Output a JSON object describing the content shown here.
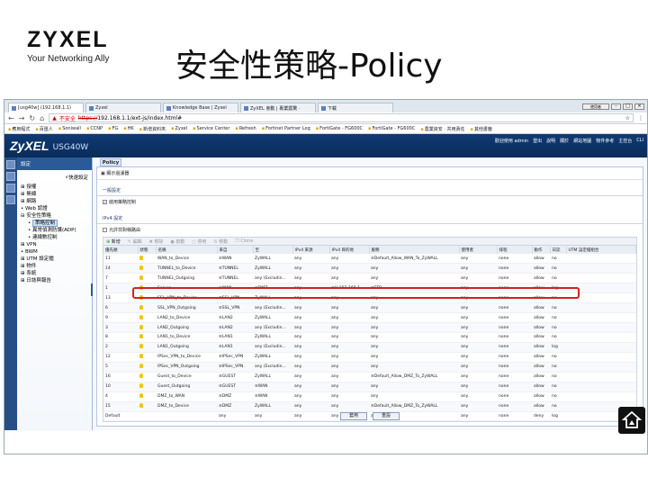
{
  "slide": {
    "logo_brand": "ZYXEL",
    "logo_tagline": "Your Networking Ally",
    "title": "安全性策略-Policy"
  },
  "browser": {
    "tabs": [
      "[usg40w] (192.168.1.1)",
      "Zyxel",
      "Knowledge Base | Zyxel",
      "ZyXEL 會動 | 專業震驚 ·",
      "下載"
    ],
    "window_user": "使用者",
    "insecure_label": "不安全",
    "url_scheme": "https://",
    "url_rest": "192.168.1.1/ext-js/index.html#",
    "bookmarks": [
      "應用程式",
      "百匯人",
      "Soniwall",
      "CCNP",
      "FG",
      "HK",
      "新增資料夾",
      "Zyxel",
      "Service Center",
      "Refresh",
      "Fortinet Partner Log",
      "FortiGate - FG600C",
      "FortiGate - FG600C",
      "農業資安 · 共用責任",
      "其他書籤"
    ]
  },
  "app": {
    "logo": "ZyXEL",
    "model": "USG40W",
    "header_links": [
      "歡迎使用 admin",
      "登出",
      "說明",
      "關於",
      "網站地圖",
      "物件參考",
      "主控台",
      "CLI"
    ],
    "sidebar_title": "設定",
    "quick_setup": "快速設定",
    "tree": [
      {
        "label": "授權",
        "level": 0,
        "icon": "plus-icon"
      },
      {
        "label": "無線",
        "level": 0,
        "icon": "plus-icon"
      },
      {
        "label": "網路",
        "level": 0,
        "icon": "plus-icon"
      },
      {
        "label": "Web 認證",
        "level": 0,
        "icon": "bullet-icon"
      },
      {
        "label": "安全性策略",
        "level": 0,
        "icon": "minus-icon"
      },
      {
        "label": "策略控制",
        "level": 1,
        "icon": "bullet-icon",
        "selected": true
      },
      {
        "label": "異常偵測防護(ADP)",
        "level": 1,
        "icon": "bullet-icon"
      },
      {
        "label": "連線數控制",
        "level": 1,
        "icon": "bullet-icon"
      },
      {
        "label": "VPN",
        "level": 0,
        "icon": "plus-icon"
      },
      {
        "label": "BWM",
        "level": 0,
        "icon": "bullet-icon"
      },
      {
        "label": "UTM 設定檔",
        "level": 0,
        "icon": "plus-icon"
      },
      {
        "label": "物件",
        "level": 0,
        "icon": "plus-icon"
      },
      {
        "label": "系統",
        "level": 0,
        "icon": "plus-icon"
      },
      {
        "label": "日誌與報告",
        "level": 0,
        "icon": "plus-icon"
      }
    ],
    "main_tab": "Policy",
    "show_filter": "顯示過濾器",
    "general_section": "一般設定",
    "enable_policy": "啟用策略控制",
    "ipv4_section": "IPv4 設定",
    "allow_asym": "允許非對稱路由",
    "toolbar": [
      {
        "label": "新增",
        "enabled": true
      },
      {
        "label": "編輯",
        "enabled": false
      },
      {
        "label": "移除",
        "enabled": false
      },
      {
        "label": "啟動",
        "enabled": false
      },
      {
        "label": "停用",
        "enabled": false
      },
      {
        "label": "移動",
        "enabled": false
      },
      {
        "label": "Clone",
        "enabled": false
      }
    ],
    "columns": [
      "優先順",
      "狀態",
      "名稱",
      "來自",
      "至",
      "IPv4 來源",
      "IPv4 目的地",
      "服務",
      "使用者",
      "排程",
      "動作",
      "日誌",
      "UTM 設定檔組合"
    ],
    "rows": [
      [
        "11",
        "",
        "WAN_to_Device",
        "≡WAN",
        "ZyWALL",
        "any",
        "any",
        "≡Default_Allow_WAN_To_ZyWALL",
        "any",
        "none",
        "allow",
        "no",
        ""
      ],
      [
        "14",
        "",
        "TUNNEL_to_Device",
        "≡TUNNEL",
        "ZyWALL",
        "any",
        "any",
        "any",
        "any",
        "none",
        "allow",
        "no",
        ""
      ],
      [
        "7",
        "",
        "TUNNEL_Outgoing",
        "≡TUNNEL",
        "any (Excludin...",
        "any",
        "any",
        "any",
        "any",
        "none",
        "allow",
        "no",
        ""
      ],
      [
        "1",
        "",
        "Server",
        "≡WAN",
        "≡DMZ",
        "any",
        "≡H-192-168-1...",
        "≡FTP",
        "any",
        "none",
        "allow",
        "log",
        ""
      ],
      [
        "13",
        "",
        "SSL_VPN_to_Device",
        "≡SSL_VPN",
        "ZyWALL",
        "any",
        "any",
        "any",
        "any",
        "none",
        "allow",
        "no",
        ""
      ],
      [
        "6",
        "",
        "SSL_VPN_Outgoing",
        "≡SSL_VPN",
        "any (Excludin...",
        "any",
        "any",
        "any",
        "any",
        "none",
        "allow",
        "no",
        ""
      ],
      [
        "9",
        "",
        "LAN2_to_Device",
        "≡LAN2",
        "ZyWALL",
        "any",
        "any",
        "any",
        "any",
        "none",
        "allow",
        "no",
        ""
      ],
      [
        "3",
        "",
        "LAN2_Outgoing",
        "≡LAN2",
        "any (Excludin...",
        "any",
        "any",
        "any",
        "any",
        "none",
        "allow",
        "no",
        ""
      ],
      [
        "8",
        "",
        "LAN1_to_Device",
        "≡LAN1",
        "ZyWALL",
        "any",
        "any",
        "any",
        "any",
        "none",
        "allow",
        "no",
        ""
      ],
      [
        "2",
        "",
        "LAN1_Outgoing",
        "≡LAN1",
        "any (Excludin...",
        "any",
        "any",
        "any",
        "any",
        "none",
        "allow",
        "log",
        ""
      ],
      [
        "12",
        "",
        "IPSec_VPN_to_Device",
        "≡IPSec_VPN",
        "ZyWALL",
        "any",
        "any",
        "any",
        "any",
        "none",
        "allow",
        "no",
        ""
      ],
      [
        "5",
        "",
        "IPSec_VPN_Outgoing",
        "≡IPSec_VPN",
        "any (Excludin...",
        "any",
        "any",
        "any",
        "any",
        "none",
        "allow",
        "no",
        ""
      ],
      [
        "16",
        "",
        "Guest_to_Device",
        "≡GUEST",
        "ZyWALL",
        "any",
        "any",
        "≡Default_Allow_DMZ_To_ZyWALL",
        "any",
        "none",
        "allow",
        "no",
        ""
      ],
      [
        "10",
        "",
        "Guest_Outgoing",
        "≡GUEST",
        "≡WAN",
        "any",
        "any",
        "any",
        "any",
        "none",
        "allow",
        "no",
        ""
      ],
      [
        "4",
        "",
        "DMZ_to_WAN",
        "≡DMZ",
        "≡WAN",
        "any",
        "any",
        "any",
        "any",
        "none",
        "allow",
        "no",
        ""
      ],
      [
        "15",
        "",
        "DMZ_to_Device",
        "≡DMZ",
        "ZyWALL",
        "any",
        "any",
        "≡Default_Allow_DMZ_To_ZyWALL",
        "any",
        "none",
        "allow",
        "no",
        ""
      ],
      [
        "Default",
        "",
        "",
        "any",
        "any",
        "any",
        "any",
        "any",
        "any",
        "none",
        "deny",
        "log",
        ""
      ]
    ],
    "apply_button": "套用",
    "reset_button": "重設"
  },
  "colors": {
    "header_bg": "#0f3a73",
    "highlight": "#d62020",
    "bulb": "#f2c315"
  }
}
